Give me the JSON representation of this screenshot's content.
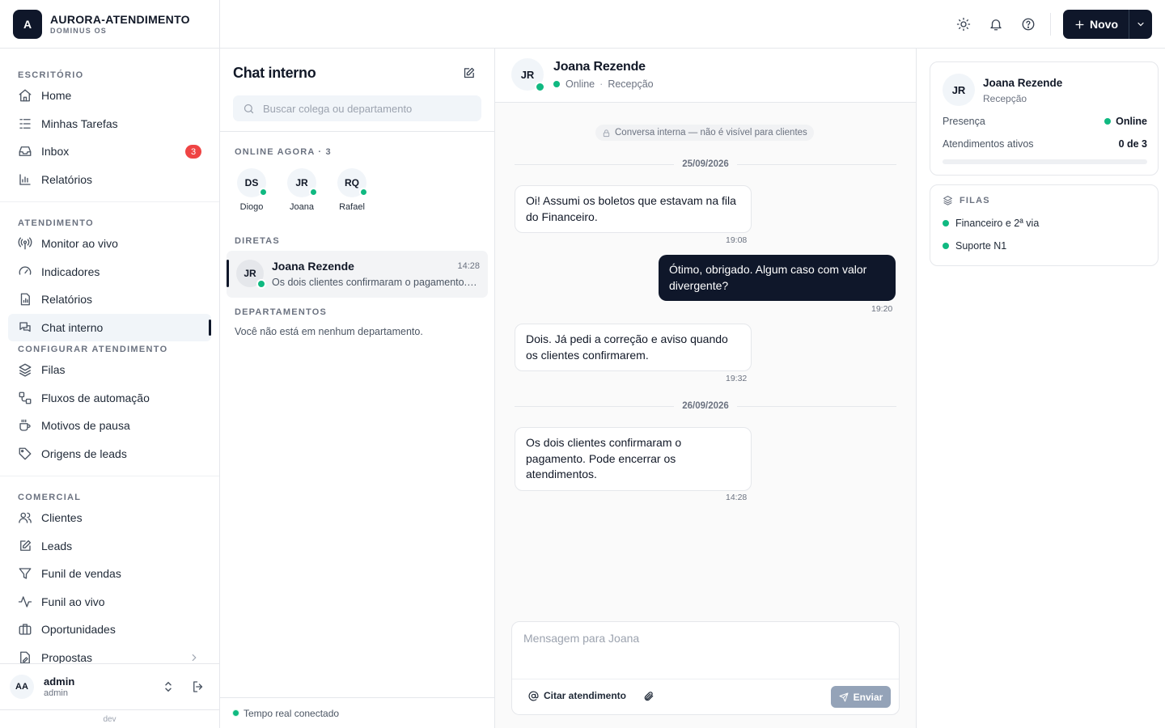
{
  "brand": {
    "logo_letter": "A",
    "name": "AURORA-ATENDIMENTO",
    "sub": "DOMINUS OS"
  },
  "nav": {
    "sections": [
      {
        "title": "ESCRITÓRIO",
        "items": [
          {
            "label": "Home",
            "icon": "home-icon"
          },
          {
            "label": "Minhas Tarefas",
            "icon": "tasks-list-icon"
          },
          {
            "label": "Inbox",
            "icon": "inbox-icon",
            "badge": "3"
          },
          {
            "label": "Relatórios",
            "icon": "bar-chart-icon"
          }
        ]
      },
      {
        "title": "ATENDIMENTO",
        "items": [
          {
            "label": "Monitor ao vivo",
            "icon": "radio-tower-icon"
          },
          {
            "label": "Indicadores",
            "icon": "gauge-icon"
          },
          {
            "label": "Relatórios",
            "icon": "report-file-icon"
          },
          {
            "label": "Chat interno",
            "icon": "chat-bubbles-icon",
            "active": true
          }
        ]
      },
      {
        "title": "CONFIGURAR ATENDIMENTO",
        "items": [
          {
            "label": "Filas",
            "icon": "layers-icon"
          },
          {
            "label": "Fluxos de automação",
            "icon": "workflow-icon"
          },
          {
            "label": "Motivos de pausa",
            "icon": "coffee-icon"
          },
          {
            "label": "Origens de leads",
            "icon": "tag-icon"
          }
        ]
      },
      {
        "title": "COMERCIAL",
        "items": [
          {
            "label": "Clientes",
            "icon": "users-icon"
          },
          {
            "label": "Leads",
            "icon": "edit-icon"
          },
          {
            "label": "Funil de vendas",
            "icon": "filter-icon"
          },
          {
            "label": "Funil ao vivo",
            "icon": "activity-icon"
          },
          {
            "label": "Oportunidades",
            "icon": "briefcase-icon"
          },
          {
            "label": "Propostas",
            "icon": "file-signature-icon"
          }
        ]
      }
    ]
  },
  "user": {
    "initials": "AA",
    "name": "admin",
    "role": "admin"
  },
  "env": "dev",
  "topbar": {
    "new_label": "Novo"
  },
  "chatlist": {
    "title": "Chat interno",
    "search_placeholder": "Buscar colega ou departamento",
    "online_label": "ONLINE AGORA · 3",
    "online_users": [
      {
        "initials": "DS",
        "name": "Diogo"
      },
      {
        "initials": "JR",
        "name": "Joana"
      },
      {
        "initials": "RQ",
        "name": "Rafael"
      }
    ],
    "direct_label": "DIRETAS",
    "directs": [
      {
        "initials": "JR",
        "name": "Joana Rezende",
        "time": "14:28",
        "preview": "Os dois clientes confirmaram o pagamento. Pode encerrar os atendimentos."
      }
    ],
    "departments_label": "DEPARTAMENTOS",
    "departments_empty": "Você não está em nenhum departamento.",
    "realtime_status": "Tempo real conectado"
  },
  "conversation": {
    "initials": "JR",
    "name": "Joana Rezende",
    "status": "Online",
    "department": "Recepção",
    "notice": "Conversa interna — não é visível para clientes",
    "dates": [
      "25/09/2026",
      "26/09/2026"
    ],
    "messages": [
      {
        "direction": "in",
        "text": "Oi! Assumi os boletos que estavam na fila do Financeiro.",
        "time": "19:08"
      },
      {
        "direction": "out",
        "text": "Ótimo, obrigado. Algum caso com valor divergente?",
        "time": "19:20"
      },
      {
        "direction": "in",
        "text": "Dois. Já pedi a correção e aviso quando os clientes confirmarem.",
        "time": "19:32"
      },
      {
        "direction": "in",
        "text": "Os dois clientes confirmaram o pagamento. Pode encerrar os atendimentos.",
        "time": "14:28"
      }
    ],
    "composer_placeholder": "Mensagem para Joana",
    "cite_label": "Citar atendimento",
    "send_label": "Enviar"
  },
  "profile": {
    "initials": "JR",
    "name": "Joana Rezende",
    "department": "Recepção",
    "presence_label": "Presença",
    "presence_value": "Online",
    "active_label": "Atendimentos ativos",
    "active_value": "0 de 3",
    "active_fraction": 0
  },
  "queues": {
    "title": "FILAS",
    "items": [
      "Financeiro e 2ª via",
      "Suporte N1"
    ]
  },
  "colors": {
    "primary": "#0f172a",
    "online": "#10b981",
    "badge": "#ef4444"
  }
}
